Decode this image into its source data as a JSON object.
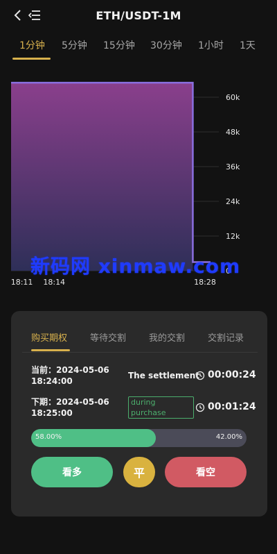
{
  "header": {
    "title": "ETH/USDT-1M",
    "back_icon": "chevron-left-icon",
    "menu_icon": "menu-icon"
  },
  "timeframe_tabs": [
    {
      "label": "1分钟",
      "active": true
    },
    {
      "label": "5分钟",
      "active": false
    },
    {
      "label": "15分钟",
      "active": false
    },
    {
      "label": "30分钟",
      "active": false
    },
    {
      "label": "1小时",
      "active": false
    },
    {
      "label": "1天",
      "active": false
    }
  ],
  "chart_data": {
    "type": "area",
    "title": "",
    "xlabel": "",
    "ylabel": "",
    "x_ticks": [
      "18:11",
      "18:14",
      "18:28"
    ],
    "y_ticks": [
      "60k",
      "48k",
      "36k",
      "24k",
      "12k",
      "0"
    ],
    "ylim": [
      0,
      66000
    ],
    "series": [
      {
        "x": [
          "18:10",
          "18:27",
          "18:28"
        ],
        "values": [
          65000,
          65000,
          3000
        ]
      }
    ],
    "colors": {
      "line": "#8b6fe0",
      "fill_top": "#8a3f8c",
      "fill_bottom": "#2e2f58"
    }
  },
  "watermark": "新码网 xinmaw.com",
  "panel": {
    "tabs": [
      {
        "label": "购买期权",
        "active": true
      },
      {
        "label": "等待交割",
        "active": false
      },
      {
        "label": "我的交割",
        "active": false
      },
      {
        "label": "交割记录",
        "active": false
      }
    ],
    "current": {
      "label": "当前：2024-05-06",
      "time": "18:24:00",
      "status": "The settlement",
      "countdown": "00:00:24"
    },
    "next": {
      "label": "下期：2024-05-06",
      "time": "18:25:00",
      "status_line1": "during",
      "status_line2": "purchase",
      "countdown": "00:01:24"
    },
    "ratio": {
      "up_label": "58.00%",
      "down_label": "42.00%",
      "up_fraction": 0.58
    },
    "buttons": {
      "long": "看多",
      "flat": "平",
      "short": "看空"
    }
  },
  "colors": {
    "accent": "#d8b14d",
    "green": "#4fbf86",
    "red": "#d15a63",
    "gold": "#d9b23f"
  }
}
